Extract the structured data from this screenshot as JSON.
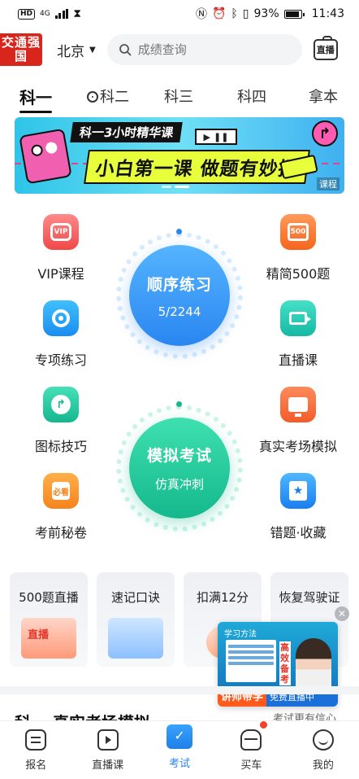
{
  "status_bar": {
    "network": "4G",
    "battery": "93%",
    "time": "11:43"
  },
  "header": {
    "logo_text": "交通强国",
    "city": "北京",
    "search_placeholder": "成绩查询",
    "live_button": "直播"
  },
  "tabs": [
    {
      "label": "科一",
      "active": true
    },
    {
      "label": "科二",
      "active": false
    },
    {
      "label": "科三",
      "active": false
    },
    {
      "label": "科四",
      "active": false
    },
    {
      "label": "拿本",
      "active": false
    }
  ],
  "banner": {
    "kicker": "科一3小时精华课",
    "headline": "小白第一课 做题有妙招",
    "tag": "课程"
  },
  "functions": {
    "vip": "VIP课程",
    "vip_icon": "VIP",
    "select500": "精简500题",
    "select500_icon": "500",
    "special": "专项练习",
    "live": "直播课",
    "signs": "图标技巧",
    "real_exam": "真实考场模拟",
    "secret": "考前秘卷",
    "secret_icon": "必看",
    "wrong": "错题·收藏"
  },
  "practice": {
    "title": "顺序练习",
    "progress": "5/2244"
  },
  "mock": {
    "title": "模拟考试",
    "subtitle": "仿真冲刺"
  },
  "cards": [
    {
      "title": "500题直播",
      "art_text": "直播"
    },
    {
      "title": "速记口诀"
    },
    {
      "title": "扣满12分"
    },
    {
      "title": "恢复驾驶证"
    }
  ],
  "promo": {
    "title": "学习方法",
    "side_text": "高效备考",
    "teacher": "讲师带学",
    "free": "免费直播中"
  },
  "section": {
    "title": "科一 真实考场模拟",
    "right": "考试更有信心"
  },
  "nav": [
    {
      "label": "报名",
      "icon": "doc",
      "active": false
    },
    {
      "label": "直播课",
      "icon": "tv",
      "active": false
    },
    {
      "label": "考试",
      "icon": "check",
      "active": true
    },
    {
      "label": "买车",
      "icon": "car",
      "active": false
    },
    {
      "label": "我的",
      "icon": "me",
      "active": false
    }
  ],
  "colors": {
    "accent_blue": "#2a86f0",
    "accent_green": "#14b88c",
    "brand_red": "#d9261c"
  }
}
